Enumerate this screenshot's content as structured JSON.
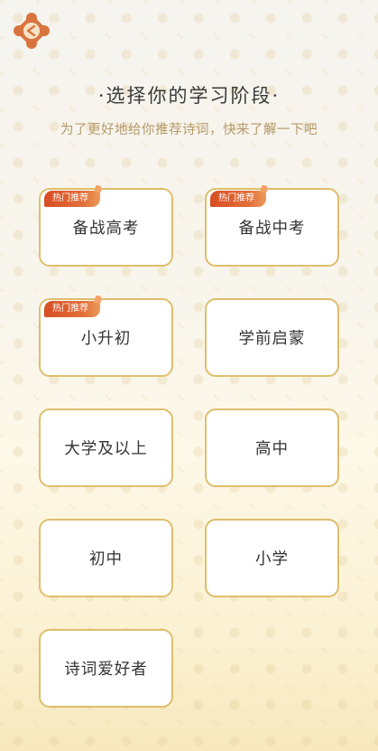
{
  "header": {
    "title": "·选择你的学习阶段·",
    "subtitle": "为了更好地给你推荐诗词，快来了解一下吧"
  },
  "badge_label": "热门推荐",
  "stages": [
    {
      "label": "备战高考",
      "hot": true
    },
    {
      "label": "备战中考",
      "hot": true
    },
    {
      "label": "小升初",
      "hot": true
    },
    {
      "label": "学前启蒙",
      "hot": false
    },
    {
      "label": "大学及以上",
      "hot": false
    },
    {
      "label": "高中",
      "hot": false
    },
    {
      "label": "初中",
      "hot": false
    },
    {
      "label": "小学",
      "hot": false
    },
    {
      "label": "诗词爱好者",
      "hot": false
    }
  ],
  "colors": {
    "card_border": "#dfbe6c",
    "badge": "#d84e23",
    "subtitle": "#b59a6a",
    "logo": "#d9743f"
  },
  "icons": {
    "logo": "app-logo-icon"
  }
}
